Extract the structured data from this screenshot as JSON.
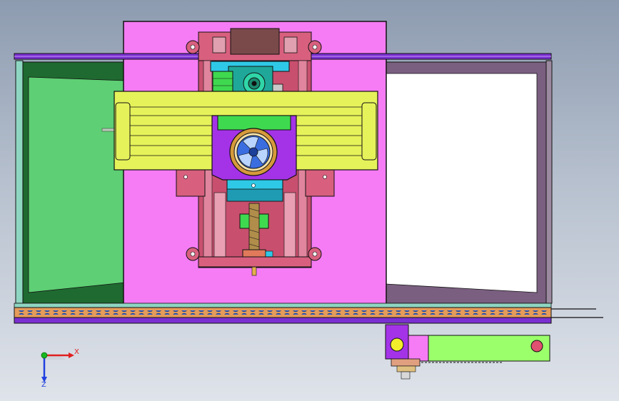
{
  "viewport": {
    "background_top": "#8d9bb0",
    "background_bottom": "#dfe3ea"
  },
  "colors": {
    "frame_purple": "#7a2fd0",
    "panel_magenta": "#f57cf4",
    "side_green": "#5ecf74",
    "side_white": "#ffffff",
    "frame_teal": "#8fd6c2",
    "carriage_yellow": "#e6f25a",
    "carriage_purple": "#a433e8",
    "rail_pink": "#d8607e",
    "rail_blue": "#3b6fd6",
    "fan_blue": "#3a6de0",
    "cyan_block": "#2ec9e6",
    "green_block": "#3fd94f",
    "motor_teal": "#1fa89a"
  },
  "triad": {
    "x_label": "X",
    "z_label": "Z",
    "x_color": "#e02020",
    "z_color": "#2040e0",
    "origin_color": "#19b81f"
  },
  "icons": [
    "axis-triad-icon",
    "cooling-fan-icon",
    "motor-icon",
    "lead-screw-icon"
  ]
}
